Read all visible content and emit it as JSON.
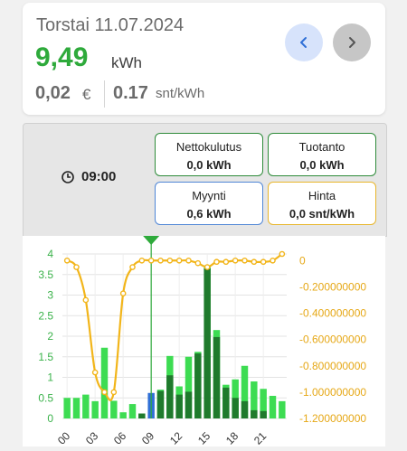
{
  "header": {
    "date": "Torstai 11.07.2024",
    "energy_value": "9,49",
    "energy_unit": "kWh",
    "cost_value": "0,02",
    "cost_unit": "€",
    "price_value": "0.17",
    "price_unit": "snt/kWh",
    "prev_icon": "chevron-left-icon",
    "next_icon": "chevron-right-icon"
  },
  "info": {
    "time": "09:00",
    "clock_icon": "clock-icon",
    "boxes": {
      "net": {
        "label": "Nettokulutus",
        "value": "0,0 kWh",
        "color": "#2e8b3a"
      },
      "prod": {
        "label": "Tuotanto",
        "value": "0,0 kWh",
        "color": "#2e8b3a"
      },
      "sale": {
        "label": "Myynti",
        "value": "0,6 kWh",
        "color": "#4f86d6"
      },
      "price": {
        "label": "Hinta",
        "value": "0,0 snt/kWh",
        "color": "#e8b62b"
      }
    }
  },
  "chart_data": {
    "type": "bar",
    "x": [
      "00",
      "01",
      "02",
      "03",
      "04",
      "05",
      "06",
      "07",
      "08",
      "09",
      "10",
      "11",
      "12",
      "13",
      "14",
      "15",
      "16",
      "17",
      "18",
      "19",
      "20",
      "21",
      "22",
      "23"
    ],
    "xticks": [
      "00",
      "03",
      "06",
      "09",
      "12",
      "15",
      "18",
      "21"
    ],
    "series": [
      {
        "values": [
          0.5,
          0.5,
          0.58,
          0.42,
          1.72,
          0.43,
          0.15,
          0.35,
          0.12,
          0.0,
          0.7,
          1.52,
          0.78,
          1.5,
          1.62,
          3.72,
          2.15,
          0.82,
          0.95,
          1.28,
          0.9,
          0.72,
          0.55,
          0.42
        ],
        "color": "#3ddc52"
      },
      {
        "values": [
          0,
          0,
          0,
          0,
          0,
          0,
          0,
          0,
          0.12,
          0,
          0.67,
          1.05,
          0.58,
          0.65,
          1.58,
          3.65,
          1.98,
          0.75,
          0.5,
          0.42,
          0.2,
          0.18,
          0,
          0
        ],
        "color": "#1f7a2c"
      },
      {
        "values": [
          0,
          0,
          0,
          0,
          0,
          0,
          0,
          0,
          0,
          0.62,
          0,
          0,
          0,
          0,
          0,
          0,
          0,
          0,
          0,
          0,
          0,
          0,
          0,
          0
        ],
        "color": "#2f6fd6"
      }
    ],
    "price_line": {
      "values": [
        -0.0,
        -0.05,
        -0.3,
        -0.85,
        -1.0,
        -1.0,
        -0.25,
        -0.05,
        0,
        0,
        0,
        0,
        0,
        0,
        -0.02,
        -0.05,
        -0.01,
        -0.01,
        0,
        0,
        -0.01,
        -0.01,
        0,
        0.05
      ],
      "color": "#f2b51a"
    },
    "y_left": {
      "ticks": [
        "0",
        "0.5",
        "1",
        "1.5",
        "2",
        "2.5",
        "3",
        "3.5",
        "4"
      ],
      "range": [
        0,
        4
      ]
    },
    "y_right": {
      "ticks": [
        "0",
        "-0.200000000",
        "-0.400000000",
        "-0.600000000",
        "-0.800000000",
        "-1.000000000",
        "-1.200000000"
      ],
      "range": [
        -1.2,
        0.05
      ]
    },
    "selected_hour": "09",
    "marker_color": "#2eaa3b"
  }
}
